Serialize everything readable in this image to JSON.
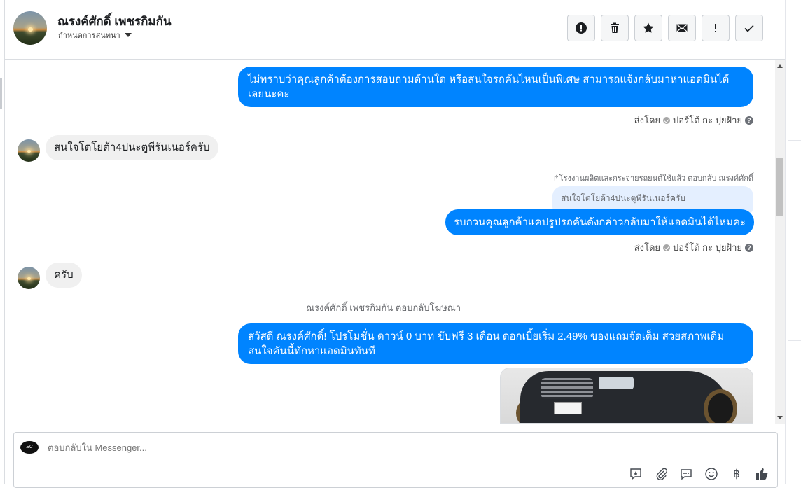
{
  "header": {
    "contact_name": "ณรงค์ศักดิ์ เพชรกิมกัน",
    "assign_label": "กำหนดการสนทนา",
    "actions": [
      {
        "name": "mark-spam-button",
        "icon": "exclamation-circle-icon"
      },
      {
        "name": "delete-button",
        "icon": "trash-icon"
      },
      {
        "name": "star-button",
        "icon": "star-icon"
      },
      {
        "name": "mark-unread-button",
        "icon": "envelope-icon"
      },
      {
        "name": "follow-up-button",
        "icon": "exclamation-icon"
      },
      {
        "name": "mark-done-button",
        "icon": "check-icon"
      }
    ]
  },
  "messages": {
    "m1": "ไม่ทราบว่าคุณลูกค้าต้องการสอบถามด้านใด หรือสนใจรถคันไหนเป็นพิเศษ สามารถแจ้งกลับมาหาแอดมินได้เลยนะคะ",
    "sent_by_1": "ส่งโดย",
    "sender_1": "ปอร์โต้ กะ ปุยฝ้าย",
    "m2": "สนใจโตโยต้า4ปนะตูพีรันเนอร์ครับ",
    "reply_label": "โรงงานผลิตและกระจายรถยนต์ใช้แล้ว ตอบกลับ ณรงค์ศักดิ์",
    "quoted": "สนใจโตโยต้า4ปนะตูพีรันเนอร์ครับ",
    "m3": "รบกวนคุณลูกค้าแคปรูปรถคันดังกล่าวกลับมาให้แอดมินได้ไหมคะ",
    "sent_by_2": "ส่งโดย",
    "sender_2": "ปอร์โต้ กะ ปุยฝ้าย",
    "m4": "ครับ",
    "ad_reply_note": "ณรงค์ศักดิ์ เพชรกิมกัน ตอบกลับโฆษณา",
    "m5": "สวัสดี ณรงค์ศักดิ์! โปรโมชั่น ดาวน์ 0 บาท ขับฟรี 3 เดือน ดอกเบี้ยเริ่ม 2.49% ของแถมจัดเต็ม สวยสภาพเดิม สนใจคันนี้ทักหาแอดมินทันที"
  },
  "composer": {
    "placeholder": "ตอบกลับใน Messenger...",
    "page_logo_text": "SC",
    "tools": [
      "saved-reply-icon",
      "attachment-icon",
      "comment-icon",
      "emoji-icon",
      "baht-icon",
      "like-icon"
    ],
    "baht_symbol": "฿"
  },
  "colors": {
    "outgoing_bubble": "#0084ff",
    "incoming_bubble": "#f0f0f0"
  }
}
